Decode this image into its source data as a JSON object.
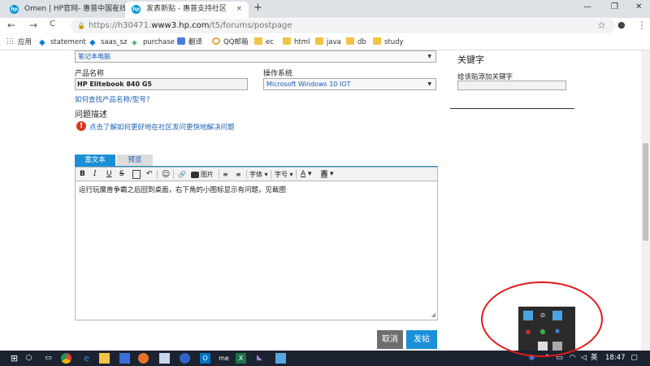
{
  "tabs": [
    {
      "title": "Omen | HP官网- 惠普中国在线",
      "close": "×",
      "icon": "hp-icon"
    },
    {
      "title": "发表新贴 - 惠普支持社区",
      "close": "×",
      "icon": "hp-icon"
    }
  ],
  "new_tab": "+",
  "window_controls": {
    "minimize": "—",
    "restore": "❐",
    "close": "✕"
  },
  "nav": {
    "back": "←",
    "forward": "→",
    "reload": "C"
  },
  "address": {
    "prefix": "https://h30471.",
    "host": "www3.hp.com",
    "path": "/t5/forums/postpage"
  },
  "toolbar_icons": {
    "star": "☆",
    "account": "●",
    "menu": "⋮"
  },
  "bookmarks": [
    "应用",
    "statement",
    "saas_sz",
    "purchase",
    "翻译",
    "QQ邮箱",
    "ec",
    "html",
    "java",
    "db",
    "study"
  ],
  "form": {
    "category_value": "笔记本电脑",
    "product_label": "产品名称",
    "product_value": "HP Elitebook 840 G5",
    "os_label": "操作系统",
    "os_value": "Microsoft Windows 10 IOT",
    "find_product_link": "如何查找产品名称/型号?",
    "problem_label": "问题描述",
    "help_link": "点击了解如何更好地在社区发问更快地解决问题",
    "alert_icon": "!"
  },
  "sidebar": {
    "keywords_title": "关键字",
    "keywords_hint": "给该贴添加关键字"
  },
  "editor": {
    "tab_rich": "富文本",
    "tab_preview": "预览",
    "toolbar": {
      "bold": "B",
      "italic": "I",
      "underline": "U",
      "strike": "S",
      "undo": "↶",
      "emoji": "☺",
      "link": "🔗",
      "image_label": "图片",
      "font_label": "字体",
      "size_label": "字号",
      "color_label": "A",
      "highlight_label": "A"
    },
    "body": "运行玩魔兽争霸之后回到桌面，右下角的小图标显示有问题，见截图"
  },
  "buttons": {
    "cancel": "取消",
    "submit": "发帖"
  },
  "taskbar": {
    "language": "英",
    "time": "18:47"
  },
  "colors": {
    "accent": "#1a8fd6",
    "cancel": "#6e6e6e",
    "annotation": "#e21b1b",
    "taskbar": "#1b2330"
  }
}
